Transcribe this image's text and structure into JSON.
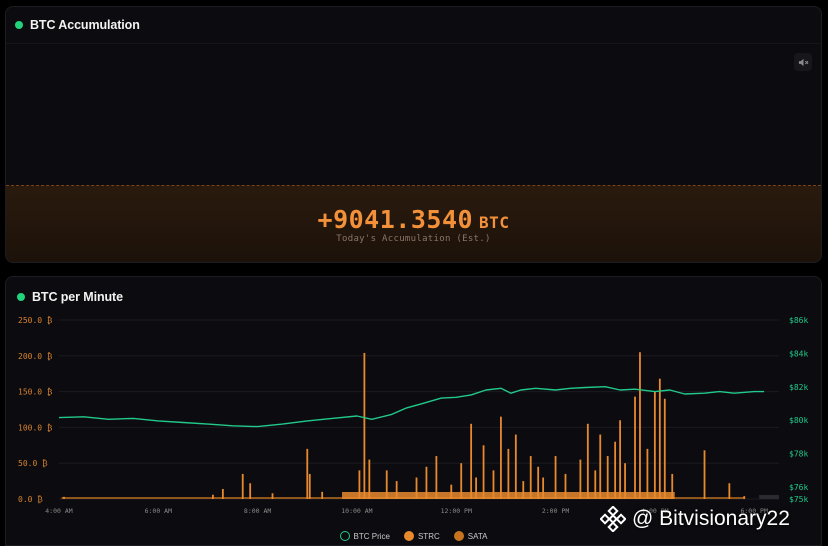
{
  "colors": {
    "accent": "#f2913a",
    "live_dot": "#22d37e",
    "price_line": "#22c98a",
    "strc": "#e8892e",
    "sata": "#c8741e"
  },
  "accumulation_panel": {
    "title": "BTC Accumulation",
    "mute_icon": "speaker-mute-icon",
    "value": "+9041.3540",
    "unit": "BTC",
    "caption": "Today's Accumulation (Est.)"
  },
  "chart_panel": {
    "title": "BTC per Minute",
    "legend": [
      {
        "label": "BTC Price",
        "color": "#22c98a",
        "style": "outline"
      },
      {
        "label": "STRC",
        "color": "#e8892e",
        "style": "filled"
      },
      {
        "label": "SATA",
        "color": "#c8741e",
        "style": "filled"
      }
    ]
  },
  "watermark": {
    "text": "@ Bitvisionary22",
    "icon": "binance-logo-icon"
  },
  "chart_data": {
    "type": "bar",
    "left_ticks": [
      "250.0 ₿",
      "200.0 ₿",
      "150.0 ₿",
      "100.0 ₿",
      "50.0 ₿",
      "0.0 ₿"
    ],
    "right_ticks": [
      "$86k",
      "$84k",
      "$82k",
      "$80k",
      "$78k",
      "$76k",
      "$75k"
    ],
    "x_ticks": [
      "4:00 AM",
      "6:00 AM",
      "8:00 AM",
      "10:00 AM",
      "12:00 PM",
      "2:00 PM",
      "4:00 PM",
      "6:00 PM"
    ],
    "ylim_left": [
      0,
      250
    ],
    "ylim_right": [
      75000,
      86000
    ],
    "xlim_hours": [
      4,
      18.5
    ],
    "spikes": [
      {
        "x": 4.1,
        "value": 3
      },
      {
        "x": 7.1,
        "value": 6
      },
      {
        "x": 7.3,
        "value": 14
      },
      {
        "x": 7.7,
        "value": 35
      },
      {
        "x": 7.85,
        "value": 22
      },
      {
        "x": 8.3,
        "value": 8
      },
      {
        "x": 9.0,
        "value": 70
      },
      {
        "x": 9.05,
        "value": 35
      },
      {
        "x": 9.3,
        "value": 10
      },
      {
        "x": 10.05,
        "value": 40
      },
      {
        "x": 10.15,
        "value": 204
      },
      {
        "x": 10.25,
        "value": 55
      },
      {
        "x": 10.6,
        "value": 40
      },
      {
        "x": 10.8,
        "value": 25
      },
      {
        "x": 11.2,
        "value": 30
      },
      {
        "x": 11.4,
        "value": 45
      },
      {
        "x": 11.6,
        "value": 60
      },
      {
        "x": 11.9,
        "value": 20
      },
      {
        "x": 12.1,
        "value": 50
      },
      {
        "x": 12.3,
        "value": 105
      },
      {
        "x": 12.4,
        "value": 30
      },
      {
        "x": 12.55,
        "value": 75
      },
      {
        "x": 12.75,
        "value": 40
      },
      {
        "x": 12.9,
        "value": 115
      },
      {
        "x": 13.05,
        "value": 70
      },
      {
        "x": 13.2,
        "value": 90
      },
      {
        "x": 13.35,
        "value": 25
      },
      {
        "x": 13.5,
        "value": 60
      },
      {
        "x": 13.65,
        "value": 45
      },
      {
        "x": 13.75,
        "value": 30
      },
      {
        "x": 14.0,
        "value": 60
      },
      {
        "x": 14.2,
        "value": 35
      },
      {
        "x": 14.5,
        "value": 55
      },
      {
        "x": 14.65,
        "value": 105
      },
      {
        "x": 14.8,
        "value": 40
      },
      {
        "x": 14.9,
        "value": 90
      },
      {
        "x": 15.05,
        "value": 60
      },
      {
        "x": 15.2,
        "value": 80
      },
      {
        "x": 15.3,
        "value": 110
      },
      {
        "x": 15.4,
        "value": 50
      },
      {
        "x": 15.6,
        "value": 143
      },
      {
        "x": 15.7,
        "value": 205
      },
      {
        "x": 15.85,
        "value": 70
      },
      {
        "x": 16.0,
        "value": 150
      },
      {
        "x": 16.1,
        "value": 168
      },
      {
        "x": 16.2,
        "value": 140
      },
      {
        "x": 16.35,
        "value": 35
      },
      {
        "x": 17.0,
        "value": 68
      },
      {
        "x": 17.5,
        "value": 22
      },
      {
        "x": 17.8,
        "value": 4
      }
    ],
    "price_series": {
      "name": "BTC Price",
      "points": [
        [
          4.0,
          80000
        ],
        [
          4.5,
          80050
        ],
        [
          5.0,
          79900
        ],
        [
          5.5,
          79950
        ],
        [
          6.0,
          79800
        ],
        [
          6.5,
          79700
        ],
        [
          7.0,
          79600
        ],
        [
          7.5,
          79500
        ],
        [
          8.0,
          79450
        ],
        [
          8.5,
          79600
        ],
        [
          9.0,
          79800
        ],
        [
          9.5,
          79950
        ],
        [
          10.0,
          80100
        ],
        [
          10.3,
          79900
        ],
        [
          10.7,
          80200
        ],
        [
          11.0,
          80600
        ],
        [
          11.3,
          80850
        ],
        [
          11.7,
          81200
        ],
        [
          12.0,
          81250
        ],
        [
          12.3,
          81400
        ],
        [
          12.6,
          81700
        ],
        [
          12.9,
          81800
        ],
        [
          13.1,
          81500
        ],
        [
          13.3,
          81700
        ],
        [
          13.6,
          81800
        ],
        [
          14.0,
          81700
        ],
        [
          14.3,
          81800
        ],
        [
          14.6,
          81850
        ],
        [
          15.0,
          81900
        ],
        [
          15.3,
          81700
        ],
        [
          15.6,
          81750
        ],
        [
          16.0,
          81600
        ],
        [
          16.3,
          81700
        ],
        [
          16.6,
          81450
        ],
        [
          17.0,
          81500
        ],
        [
          17.3,
          81600
        ],
        [
          17.6,
          81500
        ],
        [
          18.0,
          81600
        ],
        [
          18.2,
          81600
        ]
      ]
    }
  }
}
